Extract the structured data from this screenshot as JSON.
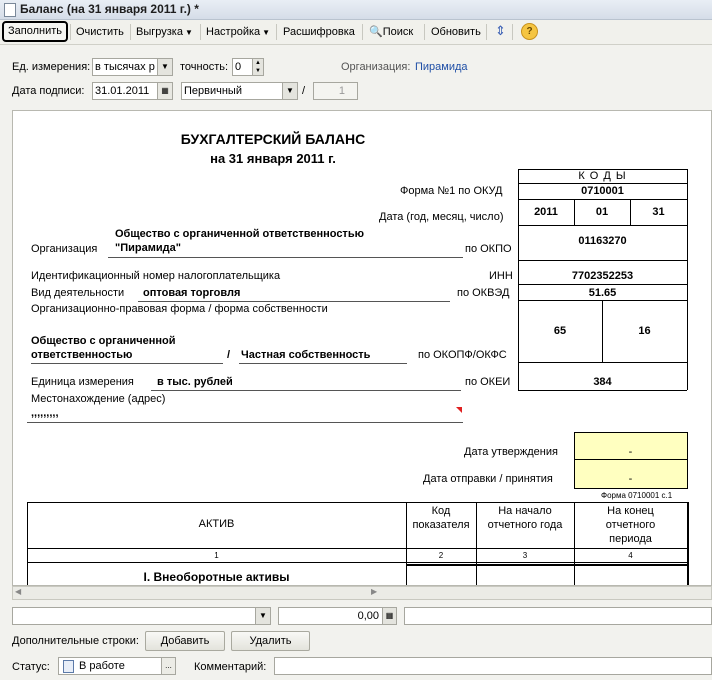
{
  "window": {
    "title": "Баланс (на 31 января 2011 г.) *"
  },
  "toolbar": {
    "fill": "Заполнить",
    "clear": "Очистить",
    "export": "Выгрузка",
    "settings": "Настройка",
    "decode": "Расшифровка",
    "search": "Поиск",
    "refresh": "Обновить",
    "help": "?"
  },
  "params": {
    "unit_label": "Ед. измерения:",
    "unit_value": "в тысячах р",
    "precision_label": "точность:",
    "precision_value": "0",
    "org_label": "Организация:",
    "org_value": "Пирамида",
    "sign_date_label": "Дата подписи:",
    "sign_date_value": "31.01.2011",
    "report_kind": "Первичный",
    "slash": "/",
    "correction_number": "1"
  },
  "report": {
    "title": "БУХГАЛТЕРСКИЙ БАЛАНС",
    "subtitle": "на 31 января 2011 г.",
    "codes_header": "К О Д Ы",
    "okud_label": "Форма №1 по ОКУД",
    "okud_value": "0710001",
    "date_label": "Дата (год, месяц, число)",
    "year": "2011",
    "month": "01",
    "day": "31",
    "org_name_line1": "Общество с органиченной ответственностью",
    "org_name_line2": "\"Пирамида\"",
    "org_label": "Организация",
    "okpo_label": "по ОКПО",
    "okpo_value": "01163270",
    "inn_text": "Идентификационный номер налогоплательщика",
    "inn_label": "ИНН",
    "inn_value": "7702352253",
    "activity_label": "Вид деятельности",
    "activity_value": "оптовая торговля",
    "okved_label": "по ОКВЭД",
    "okved_value": "51.65",
    "legal_form_text": "Организационно-правовая форма / форма собственности",
    "legal_form_line1": "Общество с органиченной",
    "legal_form_line2": "ответственностью",
    "slash": "/",
    "ownership": "Частная собственность",
    "okopf_label": "по ОКОПФ/ОКФС",
    "okopf_value": "65",
    "okfs_value": "16",
    "unit_label": "Единица измерения",
    "unit_value": "в тыс. рублей",
    "okei_label": "по ОКЕИ",
    "okei_value": "384",
    "address_label": "Местонахождение (адрес)",
    "address_value": ",,,,,,,,,",
    "approval_date_label": "Дата утверждения",
    "approval_date_value": "-",
    "send_date_label": "Дата отправки / принятия",
    "send_date_value": "-",
    "form_note": "Форма 0710001 с.1",
    "table": {
      "col_asset": "АКТИВ",
      "col_code_l1": "Код",
      "col_code_l2": "показателя",
      "col_start_l1": "На начало",
      "col_start_l2": "отчетного года",
      "col_end_l1": "На конец",
      "col_end_l2": "отчетного",
      "col_end_l3": "периода",
      "num1": "1",
      "num2": "2",
      "num3": "3",
      "num4": "4",
      "section1": "I. Внеоборотные активы"
    }
  },
  "bottom": {
    "amount_value": "0,00",
    "extra_rows_label": "Дополнительные строки:",
    "add_button": "Добавить",
    "delete_button": "Удалить",
    "status_label": "Статус:",
    "status_value": "В работе",
    "ellipsis": "...",
    "comment_label": "Комментарий:"
  },
  "colors": {
    "accent_link": "#1f4fa6",
    "highlight_cell": "#ffffc0",
    "toolbar_bg": "#f1f1ec"
  }
}
